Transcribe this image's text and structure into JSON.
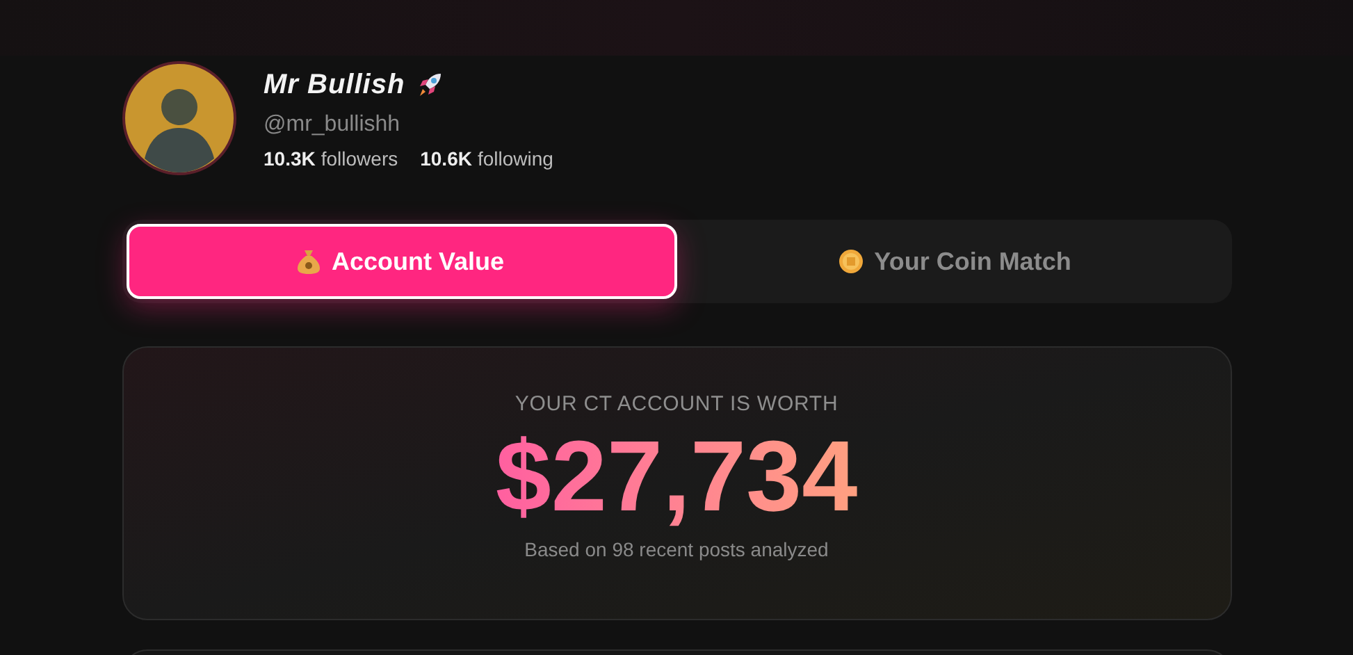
{
  "profile": {
    "name": "Mr Bullish",
    "handle": "@mr_bullishh",
    "followers_count": "10.3K",
    "followers_label": "followers",
    "following_count": "10.6K",
    "following_label": "following"
  },
  "tabs": [
    {
      "label": "Account Value",
      "kind": "moneybag",
      "selected": true
    },
    {
      "label": "Your Coin Match",
      "kind": "coin",
      "selected": false
    }
  ],
  "value_card": {
    "heading": "YOUR CT ACCOUNT IS WORTH",
    "value": "$27,734",
    "note": "Based on 98 recent posts analyzed"
  }
}
